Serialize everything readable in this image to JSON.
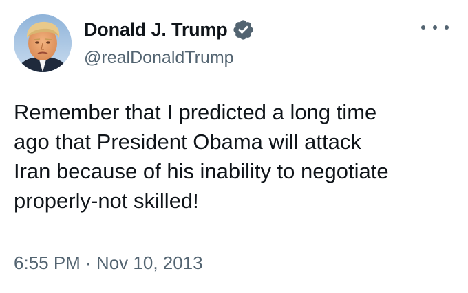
{
  "tweet": {
    "display_name": "Donald J. Trump",
    "handle": "@realDonaldTrump",
    "verified_icon": "verified-badge-icon",
    "more_icon": "more-options-icon",
    "text": "Remember that I predicted a long time\nago that President Obama will attack\nIran because of his inability to negotiate\nproperly-not skilled!",
    "timestamp": "6:55 PM · Nov 10, 2013"
  },
  "colors": {
    "text_primary": "#0f1419",
    "text_secondary": "#536471",
    "verified_badge": "#536471",
    "background": "#ffffff"
  }
}
